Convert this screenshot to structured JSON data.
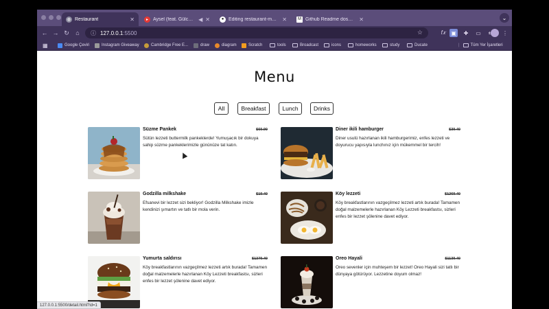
{
  "browser": {
    "tabs": [
      {
        "label": "Restaurant",
        "active": true
      },
      {
        "label": "Aysel (feat. Gülce Duru)",
        "active": false
      },
      {
        "label": "Editing restaurant-menu/README.md",
        "active": false
      },
      {
        "label": "Github Readme dosyasına g…",
        "active": false
      }
    ],
    "url_host": "127.0.0.1",
    "url_port": ":5500",
    "bookmarks": [
      {
        "label": "Google Çeviri",
        "icon_color": "#4a8af4"
      },
      {
        "label": "Instagram Giveaway",
        "icon_color": "#9a9a9a"
      },
      {
        "label": "Cambridge Free E...",
        "icon_color": "#c69b3a"
      },
      {
        "label": "draw",
        "icon_color": "#6d6d7a"
      },
      {
        "label": "diagram",
        "icon_color": "#e8892b"
      },
      {
        "label": "Scratch",
        "icon_color": "#f39c1f"
      },
      {
        "label": "tools",
        "icon_color": ""
      },
      {
        "label": "Broadcast",
        "icon_color": ""
      },
      {
        "label": "icons",
        "icon_color": ""
      },
      {
        "label": "homeworks",
        "icon_color": ""
      },
      {
        "label": "study",
        "icon_color": ""
      },
      {
        "label": "Ducate",
        "icon_color": ""
      },
      {
        "label": "Tüm Yer İşaretleri",
        "icon_color": ""
      }
    ],
    "status_url": "127.0.0.1:5500/detail.html?id=1"
  },
  "page": {
    "title": "Menu",
    "categories": [
      "All",
      "Breakfast",
      "Lunch",
      "Drinks"
    ]
  },
  "menu": [
    {
      "name": "Süzme Pankek",
      "price": "$69.90",
      "desc": "Sütün lezzeti buttermilk pankeklerde! Yumuşacık bir dokuya sahip süzme pankeklerimizle gününüze tat katın.",
      "photo": "pancakes"
    },
    {
      "name": "Diner ikili hamburger",
      "price": "$39.40",
      "desc": "Diner usulü hazırlanan ikili hamburgerimiz, enfes lezzeti ve doyurucu yapısıyla lunchınız için mükemmel bir tercih!",
      "photo": "burger-fries"
    },
    {
      "name": "Godzilla milkshake",
      "price": "$19.40",
      "desc": "Efsanevi bir lezzet sizi bekliyor! Godzilla Milkshake imizle kendinizi şımartın ve tatlı bir mola verin.",
      "photo": "milkshake"
    },
    {
      "name": "Köy lezzeti",
      "price": "$1269.40",
      "desc": "Köy breakfastlarının vazgeçilmez lezzeti artık burada! Tamamen doğal malzemelerle hazırlanan Köy Lezzeti breakfastsı, sizleri enfes bir lezzet şölenine davet ediyor.",
      "photo": "village-breakfast"
    },
    {
      "name": "Yumurta saldırısı",
      "price": "$1379.40",
      "desc": "Köy breakfastlarının vazgeçilmez lezzeti artık burada! Tamamen doğal malzemelerle hazırlanan Köy Lezzeti breakfastsı, sizleri enfes bir lezzet şölenine davet ediyor.",
      "photo": "egg-burger"
    },
    {
      "name": "Oreo Hayali",
      "price": "$1139.40",
      "desc": "Oreo sevenler için muhteşem bir lezzet! Oreo Hayali sizi tatlı bir dünyaya götürüyor. Lezzetine doyum olmaz!",
      "photo": "oreo-shake"
    }
  ]
}
